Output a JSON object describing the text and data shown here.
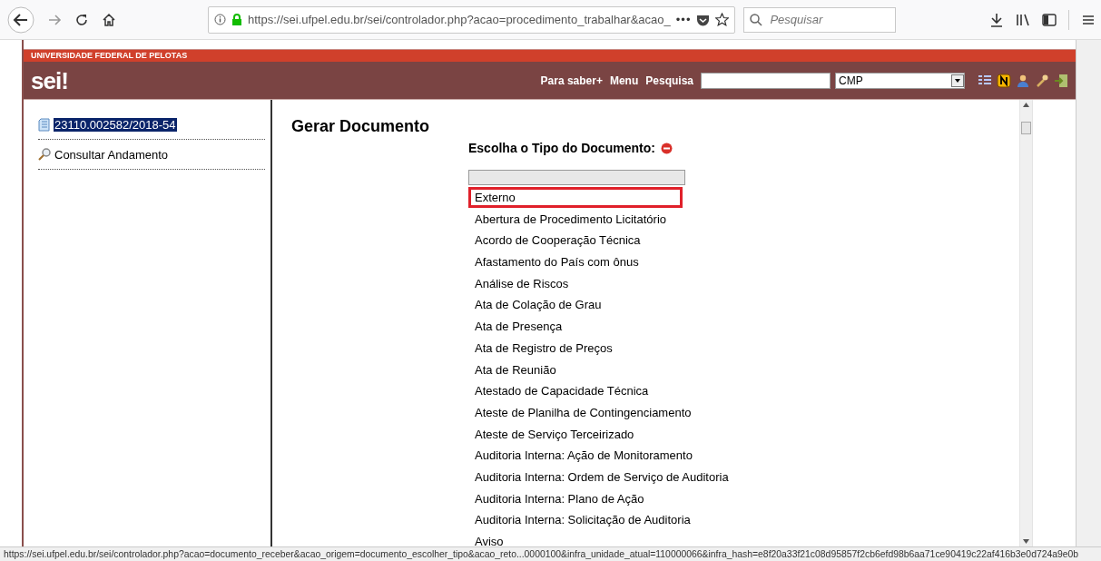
{
  "browser": {
    "url": "https://sei.ufpel.edu.br/sei/controlador.php?acao=procedimento_trabalhar&acao_",
    "more": "•••",
    "search": {
      "placeholder": "Pesquisar"
    }
  },
  "header": {
    "institution": "UNIVERSIDADE FEDERAL DE PELOTAS",
    "logo": "sei!",
    "links": [
      "Para saber+",
      "Menu",
      "Pesquisa"
    ],
    "unit_select": {
      "value": "CMP"
    }
  },
  "sidebar": {
    "items": [
      {
        "kind": "process",
        "label": "23110.002582/2018-54",
        "selected": true
      },
      {
        "kind": "search",
        "label": "Consultar Andamento",
        "selected": false
      }
    ]
  },
  "main": {
    "title": "Gerar Documento",
    "prompt": "Escolha o Tipo do Documento:",
    "types": [
      {
        "label": "Externo",
        "selected": true
      },
      {
        "label": "Abertura de Procedimento Licitatório",
        "selected": false
      },
      {
        "label": "Acordo de Cooperação Técnica",
        "selected": false
      },
      {
        "label": "Afastamento do País com ônus",
        "selected": false
      },
      {
        "label": "Análise de Riscos",
        "selected": false
      },
      {
        "label": "Ata de Colação de Grau",
        "selected": false
      },
      {
        "label": "Ata de Presença",
        "selected": false
      },
      {
        "label": "Ata de Registro de Preços",
        "selected": false
      },
      {
        "label": "Ata de Reunião",
        "selected": false
      },
      {
        "label": "Atestado de Capacidade Técnica",
        "selected": false
      },
      {
        "label": "Ateste de Planilha de Contingenciamento",
        "selected": false
      },
      {
        "label": "Ateste de Serviço Terceirizado",
        "selected": false
      },
      {
        "label": "Auditoria Interna: Ação de Monitoramento",
        "selected": false
      },
      {
        "label": "Auditoria Interna: Ordem de Serviço de Auditoria",
        "selected": false
      },
      {
        "label": "Auditoria Interna: Plano de Ação",
        "selected": false
      },
      {
        "label": "Auditoria Interna: Solicitação de Auditoria",
        "selected": false
      },
      {
        "label": "Aviso",
        "selected": false
      }
    ]
  },
  "status_bar": {
    "text": "https://sei.ufpel.edu.br/sei/controlador.php?acao=documento_receber&acao_origem=documento_escolher_tipo&acao_reto...0000100&infra_unidade_atual=110000066&infra_hash=e8f20a33f21c08d95857f2cb6efd98b6aa71ce90419c22af416b3e0d724a9e0b"
  }
}
